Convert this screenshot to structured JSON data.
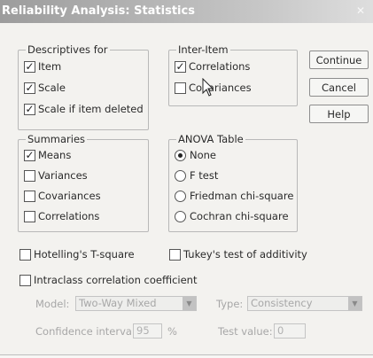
{
  "window": {
    "title": "Reliability Analysis: Statistics",
    "close_glyph": "✕"
  },
  "descriptives": {
    "legend": "Descriptives for",
    "items": [
      {
        "label": "Item",
        "checked": true
      },
      {
        "label": "Scale",
        "checked": true
      },
      {
        "label": "Scale if item deleted",
        "checked": true
      }
    ]
  },
  "inter_item": {
    "legend": "Inter-Item",
    "items": [
      {
        "label": "Correlations",
        "checked": true
      },
      {
        "label": "Covariances",
        "checked": false
      }
    ]
  },
  "summaries": {
    "legend": "Summaries",
    "items": [
      {
        "label": "Means",
        "checked": true
      },
      {
        "label": "Variances",
        "checked": false
      },
      {
        "label": "Covariances",
        "checked": false
      },
      {
        "label": "Correlations",
        "checked": false
      }
    ]
  },
  "anova": {
    "legend": "ANOVA Table",
    "options": [
      {
        "label": "None",
        "selected": true
      },
      {
        "label": "F test",
        "selected": false
      },
      {
        "label": "Friedman chi-square",
        "selected": false
      },
      {
        "label": "Cochran chi-square",
        "selected": false
      }
    ]
  },
  "buttons": {
    "continue": "Continue",
    "cancel": "Cancel",
    "help": "Help"
  },
  "options": {
    "hotelling": {
      "label": "Hotelling's T-square",
      "checked": false
    },
    "tukey": {
      "label": "Tukey's test of additivity",
      "checked": false
    },
    "intraclass": {
      "label": "Intraclass correlation coefficient",
      "checked": false
    }
  },
  "icc": {
    "model_label": "Model:",
    "model_value": "Two-Way Mixed",
    "type_label": "Type:",
    "type_value": "Consistency",
    "confidence_label": "Confidence interval:",
    "confidence_value": "95",
    "confidence_unit": "%",
    "test_value_label": "Test value:",
    "test_value": "0"
  },
  "icons": {
    "checkmark": "✓",
    "dropdown_arrow": "▼",
    "cursor": "mouse-pointer-icon"
  },
  "colors": {
    "title_bar_start": "#9c9c9c",
    "dialog_background": "#f3f2ef",
    "disabled_text": "#a7a7a7"
  }
}
